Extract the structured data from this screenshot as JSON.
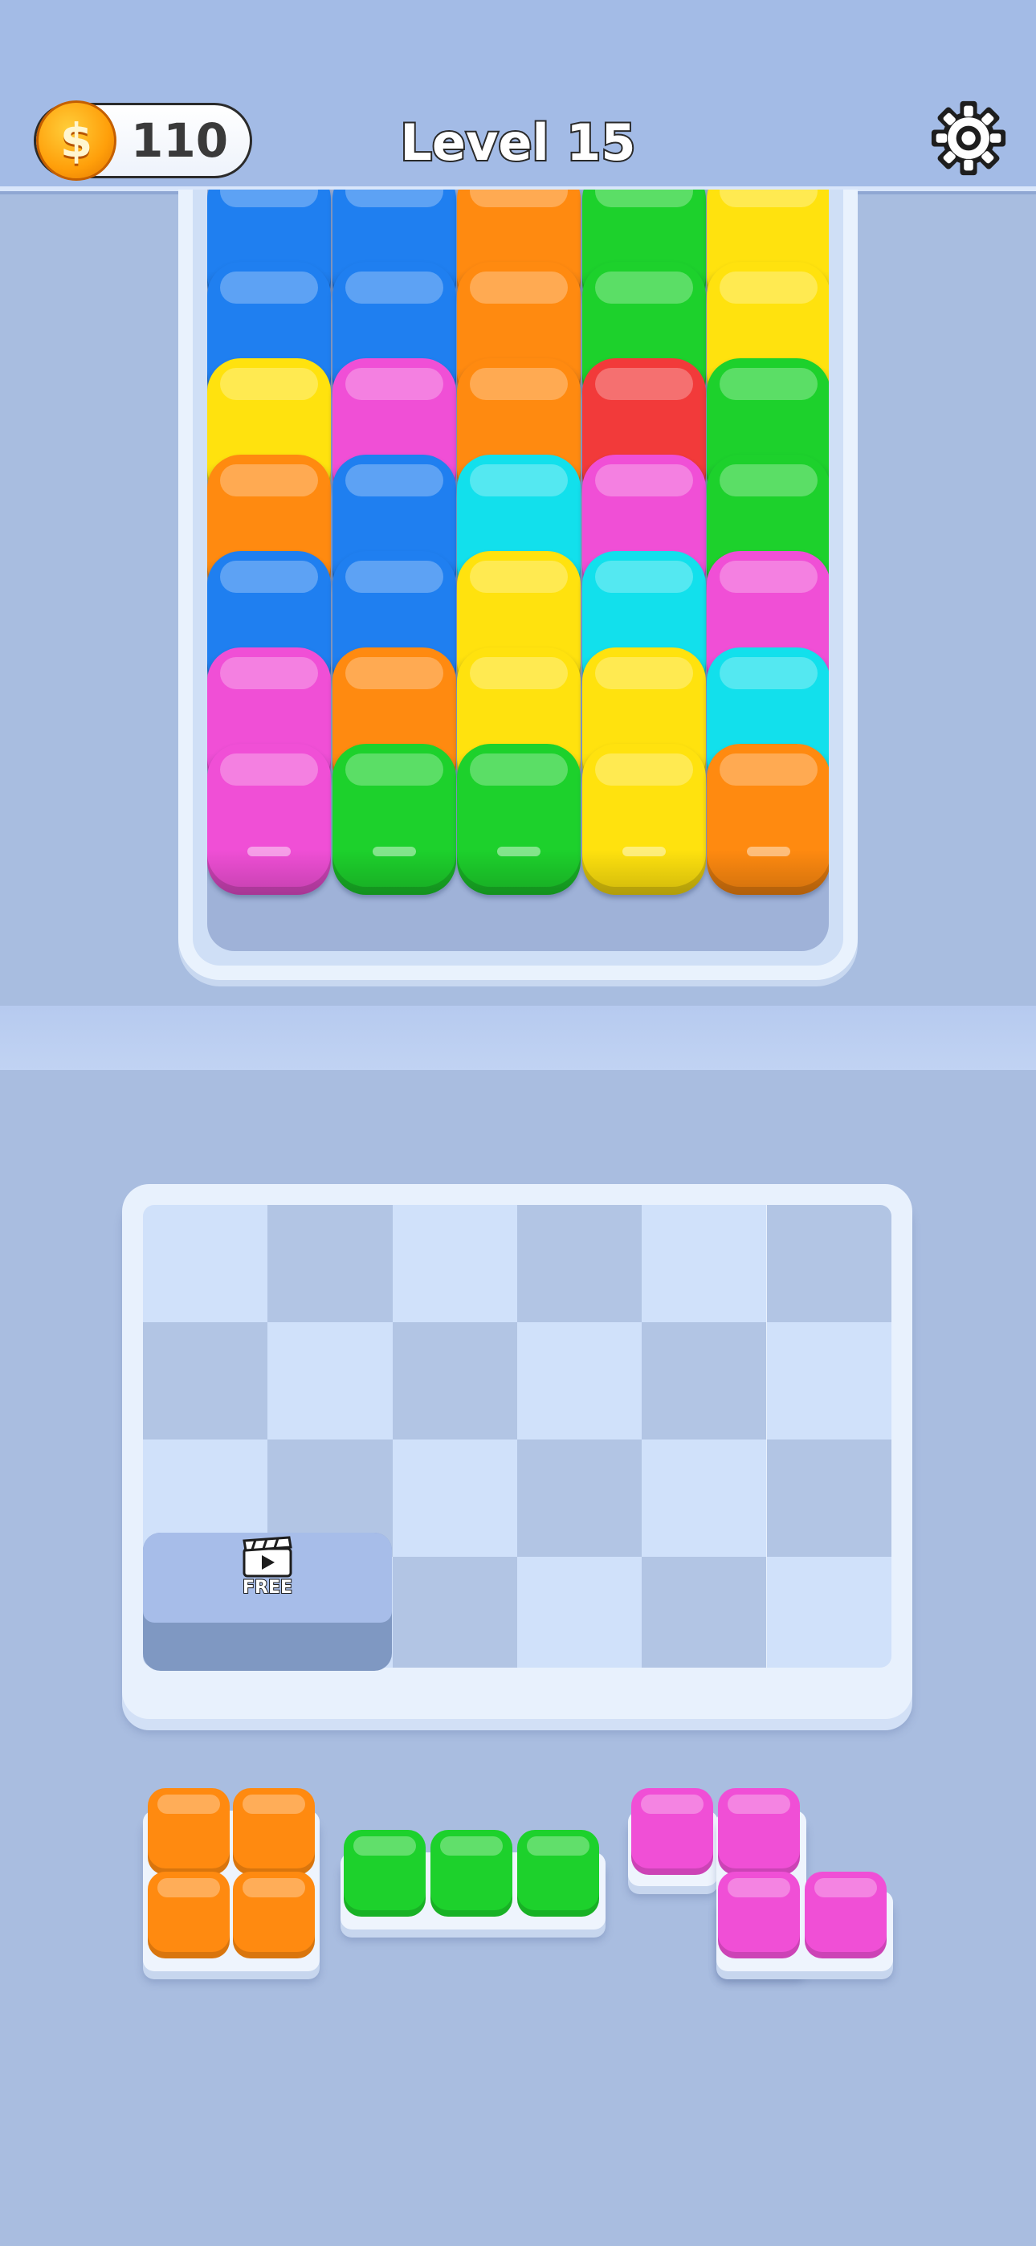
{
  "hud": {
    "coins": "110",
    "level_title": "Level 15",
    "coin_symbol": "$"
  },
  "colors": {
    "blue": "#1f7ff0",
    "orange": "#ff8a10",
    "green": "#1dd12c",
    "yellow": "#ffe20e",
    "pink": "#f04fd6",
    "red": "#f23a3a",
    "cyan": "#12e0ec"
  },
  "jar": {
    "columns": 5,
    "rows": [
      [
        "blue",
        "blue",
        "orange",
        "green",
        "yellow"
      ],
      [
        "blue",
        "blue",
        "orange",
        "green",
        "yellow"
      ],
      [
        "yellow",
        "pink",
        "orange",
        "red",
        "green"
      ],
      [
        "orange",
        "blue",
        "cyan",
        "pink",
        "green"
      ],
      [
        "blue",
        "blue",
        "yellow",
        "cyan",
        "pink"
      ],
      [
        "pink",
        "orange",
        "yellow",
        "yellow",
        "cyan"
      ],
      [
        "pink",
        "green",
        "green",
        "yellow",
        "orange"
      ]
    ]
  },
  "board": {
    "columns": 6,
    "rows": 4,
    "free_slot_label": "FREE"
  },
  "tray": [
    {
      "name": "orange-square-piece",
      "color": "orange"
    },
    {
      "name": "green-line-piece",
      "color": "green"
    },
    {
      "name": "pink-z-piece",
      "color": "pink"
    }
  ]
}
